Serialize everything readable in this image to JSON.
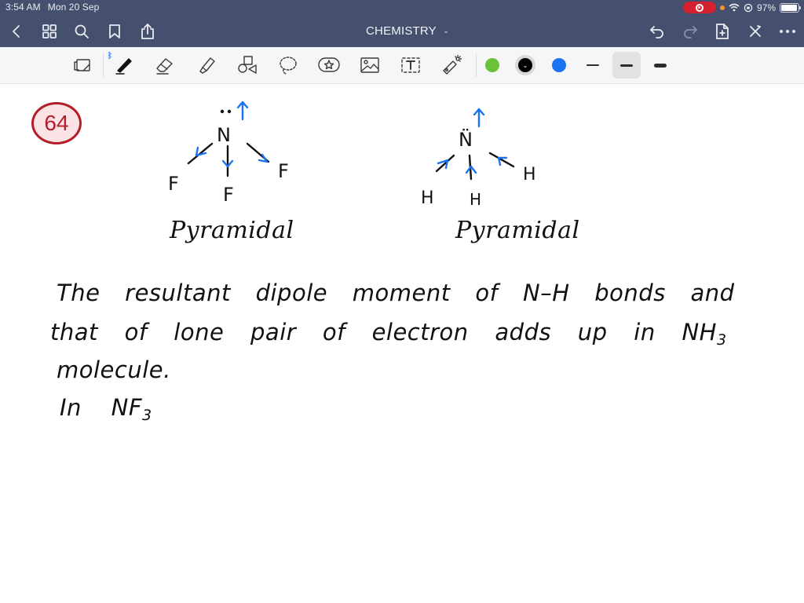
{
  "status_bar": {
    "time": "3:54 AM",
    "date": "Mon 20 Sep",
    "battery": "97%",
    "battery_level": 0.97,
    "icons": [
      "screen-record-icon",
      "orientation-dot-icon",
      "wifi-icon",
      "orientation-lock-icon",
      "battery-icon"
    ]
  },
  "nav": {
    "title": "CHEMISTRY",
    "title_dropdown_icon": "chevron-down-icon",
    "left_icons": [
      "back-icon",
      "grid-icon",
      "search-icon",
      "bookmark-icon",
      "share-icon"
    ],
    "right_icons": [
      "undo-icon",
      "redo-icon",
      "add-page-icon",
      "close-toolbar-icon",
      "more-icon"
    ]
  },
  "toolbar": {
    "tools": [
      "read-only-icon",
      "pen-icon",
      "eraser-icon",
      "highlighter-icon",
      "shapes-icon",
      "lasso-icon",
      "elements-icon",
      "image-icon",
      "text-icon",
      "laser-pointer-icon"
    ],
    "selected_tool": "pen",
    "bluetooth_indicator": "ᛒ",
    "colors": [
      {
        "name": "green",
        "hex": "#6ac13a"
      },
      {
        "name": "black",
        "hex": "#000000",
        "selected": true
      },
      {
        "name": "blue",
        "hex": "#1a73f0"
      }
    ],
    "stroke_widths": [
      "thin",
      "medium",
      "thick"
    ],
    "selected_stroke": "medium"
  },
  "canvas": {
    "question_number": "64",
    "badge_color": "#b21e2a",
    "nf3": {
      "central_atom": "N",
      "lone_pair": "··",
      "ligands": [
        "F",
        "F",
        "F"
      ],
      "caption": "Pyramidal"
    },
    "nh3": {
      "central_atom": "N̈",
      "ligands": [
        "H",
        "H",
        "H"
      ],
      "caption": "Pyramidal"
    },
    "arrow_color": "#1a73f0",
    "text_lines": [
      "The resultant dipole moment of N–H bonds and",
      "that of lone pair of electron adds up in NH",
      "molecule.",
      "In NF"
    ],
    "subscripts": [
      "3",
      "3"
    ]
  }
}
